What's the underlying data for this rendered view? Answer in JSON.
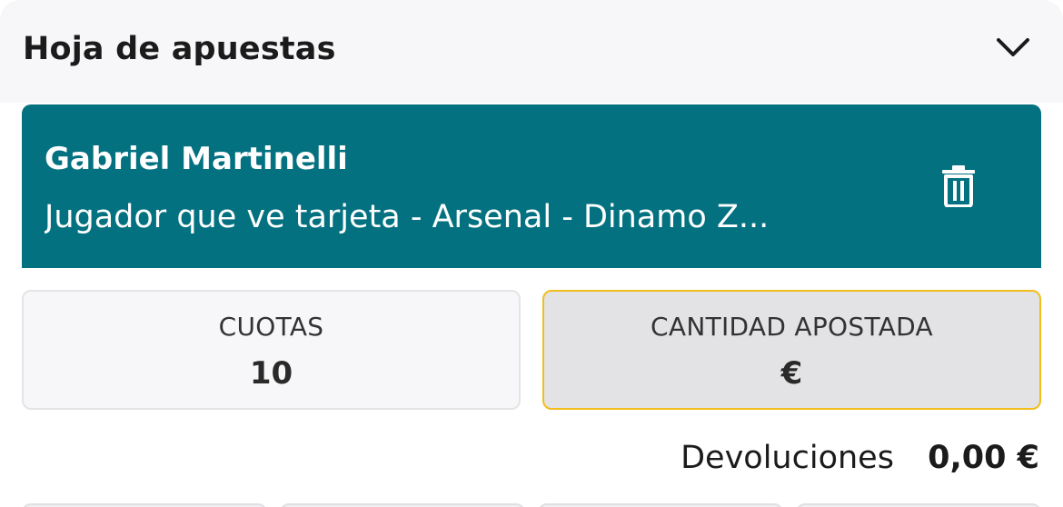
{
  "header": {
    "title": "Hoja de apuestas",
    "collapse_icon": "chevron-down-icon"
  },
  "selection": {
    "name": "Gabriel Martinelli",
    "market": "Jugador que ve tarjeta - Arsenal - Dinamo Z...",
    "delete_icon": "trash-icon",
    "background_color": "#037180"
  },
  "odds": {
    "label": "CUOTAS",
    "value": "10"
  },
  "stake": {
    "label": "CANTIDAD APOSTADA",
    "value": "€",
    "border_color": "#f2bd1c"
  },
  "returns": {
    "label": "Devoluciones",
    "value": "0,00 €"
  }
}
